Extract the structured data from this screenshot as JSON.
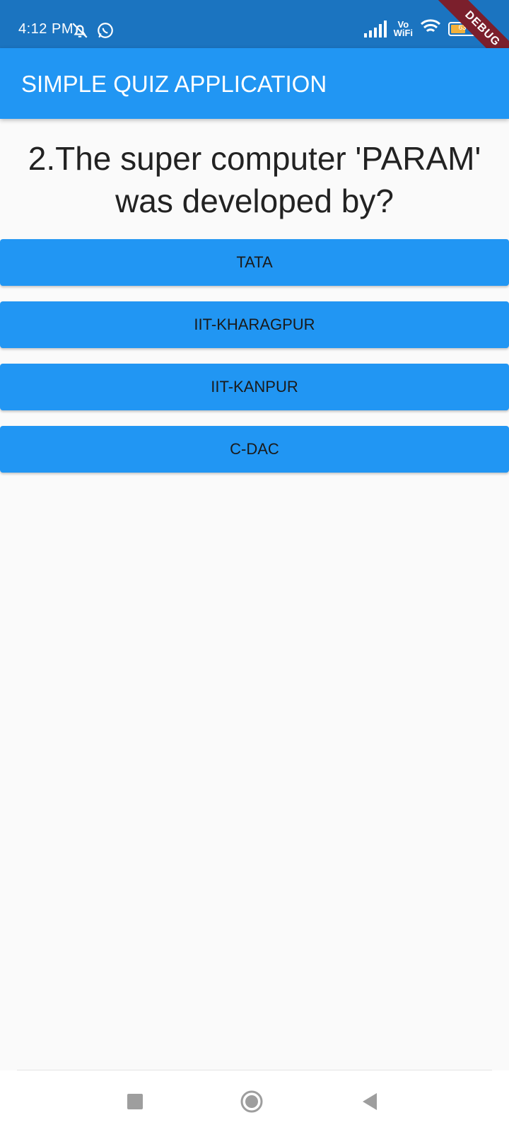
{
  "status_bar": {
    "time": "4:12 PM",
    "vowifi_top": "Vo",
    "vowifi_bottom": "WiFi",
    "battery_level": "63",
    "battery_fraction": 0.63,
    "debug_banner": "DEBUG"
  },
  "app_bar": {
    "title": "SIMPLE QUIZ APPLICATION"
  },
  "quiz": {
    "question": "2.The super computer 'PARAM' was developed by?",
    "answers": [
      {
        "label": "TATA"
      },
      {
        "label": "IIT-KHARAGPUR"
      },
      {
        "label": "IIT-KANPUR"
      },
      {
        "label": "C-DAC"
      }
    ]
  },
  "icons": {
    "status": [
      "notifications-off-icon",
      "whatsapp-icon",
      "signal-icon",
      "wifi-icon",
      "battery-icon"
    ],
    "navigation": [
      "recent-apps-icon",
      "home-icon",
      "back-icon"
    ]
  },
  "colors": {
    "status_bar": "#1b74c0",
    "app_bar": "#2196f3",
    "answer_button": "#2196f3",
    "background": "#fafafa",
    "debug_banner": "#7b1f2c"
  }
}
